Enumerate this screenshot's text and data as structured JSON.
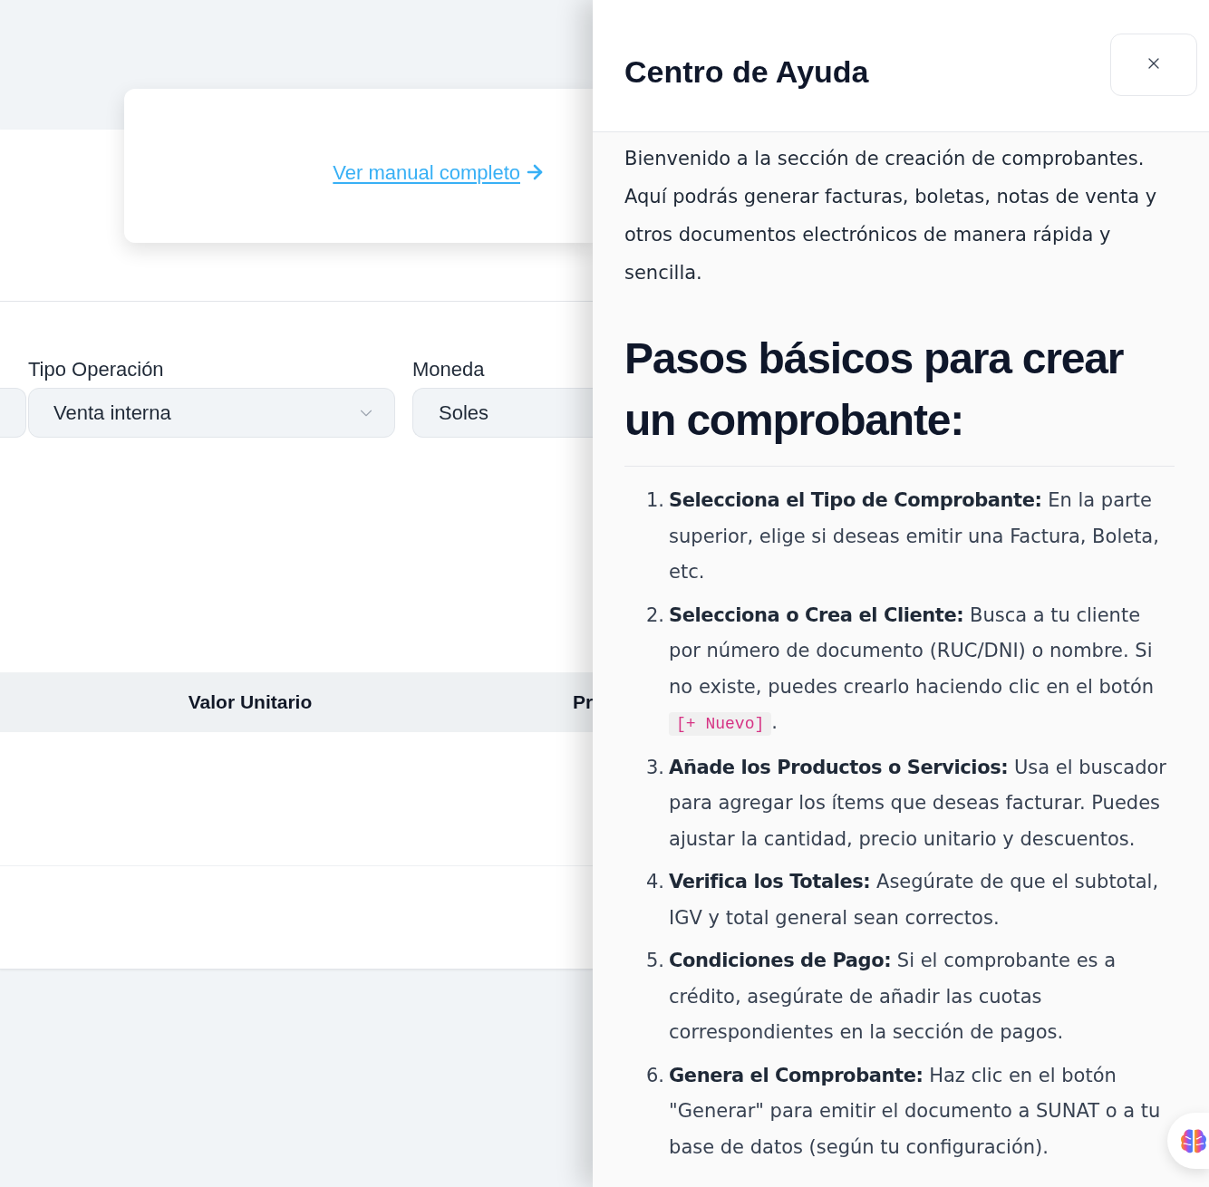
{
  "page": {
    "manual_link": {
      "label": "Ver manual completo"
    },
    "fields": [
      {
        "kind": "box"
      },
      {
        "kind": "select",
        "label": "Tipo Operación",
        "value": "Venta interna"
      },
      {
        "kind": "box",
        "label": "Moneda",
        "value": "Soles"
      }
    ],
    "table": {
      "columns": [
        "Valor Unitario",
        "Pr"
      ]
    }
  },
  "help_panel": {
    "title": "Centro de Ayuda",
    "intro": "Bienvenido a la sección de creación de comprobantes. Aquí podrás generar facturas, boletas, notas de venta y otros documentos electrónicos de manera rápida y sencilla.",
    "heading": "Pasos básicos para crear un comprobante:",
    "steps": [
      {
        "number": "1.",
        "text": "**Selecciona el Tipo de Comprobante:** En la parte superior, elige si deseas emitir una Factura, Boleta, etc."
      },
      {
        "number": "2.",
        "text": "**Selecciona o Crea el Cliente:** Busca a tu cliente por número de documento (RUC/DNI) o nombre. Si no existe, puedes crearlo haciendo clic en el botón",
        "code": "[+ Nuevo]",
        "text_after": "."
      },
      {
        "number": "3.",
        "text": "**Añade los Productos o Servicios:** Usa el buscador para agregar los ítems que deseas facturar. Puedes ajustar la cantidad, precio unitario y descuentos."
      },
      {
        "number": "4.",
        "text": "**Verifica los Totales:** Asegúrate de que el subtotal, IGV y total general sean correctos."
      },
      {
        "number": "5.",
        "text": "**Condiciones de Pago:** Si el comprobante es a crédito, asegúrate de añadir las cuotas correspondientes en la sección de pagos."
      },
      {
        "number": "6.",
        "text": "**Genera el Comprobante:** Haz clic en el botón \"Generar\" para emitir el documento a SUNAT o a tu base de datos (según tu configuración)."
      }
    ]
  }
}
